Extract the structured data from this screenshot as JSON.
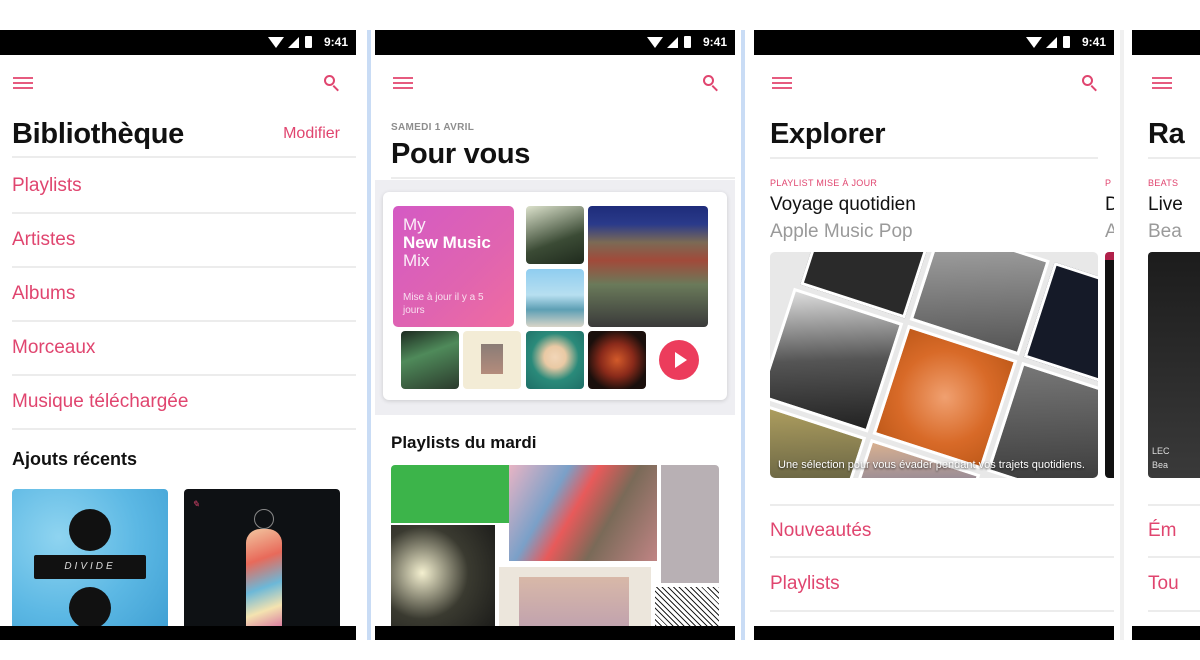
{
  "status_bar": {
    "time": "9:41",
    "icons": [
      "wifi-icon",
      "signal-icon",
      "battery-icon"
    ]
  },
  "colors": {
    "accent": "#e0456f",
    "play_button": "#ec3c5c",
    "mix_gradient_start": "#d45ac4",
    "mix_gradient_end": "#f06ca0",
    "divider": "#c9dcf5"
  },
  "screens": [
    {
      "id": "library",
      "title": "Bibliothèque",
      "edit_label": "Modifier",
      "items": [
        {
          "label": "Playlists"
        },
        {
          "label": "Artistes"
        },
        {
          "label": "Albums"
        },
        {
          "label": "Morceaux"
        },
        {
          "label": "Musique téléchargée"
        }
      ],
      "recent_heading": "Ajouts récents",
      "recent_albums": [
        {
          "art": "divide-album-art",
          "cover_text": "DIVIDE"
        },
        {
          "art": "colorful-figure-album-art"
        }
      ]
    },
    {
      "id": "for-you",
      "date_label": "SAMEDI 1 AVRIL",
      "title": "Pour vous",
      "mix": {
        "line1": "My",
        "line2": "New Music",
        "line3": "Mix",
        "subtitle": "Mise à jour il y a 5 jours"
      },
      "section_heading": "Playlists du mardi"
    },
    {
      "id": "browse",
      "title": "Explorer",
      "featured": {
        "kicker": "PLAYLIST MISE À JOUR",
        "title": "Voyage quotidien",
        "subtitle": "Apple Music Pop",
        "caption": "Une sélection pour vous évader pendant vos trajets quotidiens."
      },
      "next_featured": {
        "kicker": "P",
        "title": "D",
        "subtitle": "A"
      },
      "items": [
        {
          "label": "Nouveautés"
        },
        {
          "label": "Playlists"
        }
      ]
    },
    {
      "id": "radio",
      "title": "Ra",
      "featured": {
        "kicker": "BEATS",
        "title": "Live",
        "subtitle": "Bea",
        "caption_l1": "LEC",
        "caption_l2": "Bea"
      },
      "items": [
        {
          "label": "Ém"
        },
        {
          "label": "Tou"
        }
      ]
    }
  ]
}
